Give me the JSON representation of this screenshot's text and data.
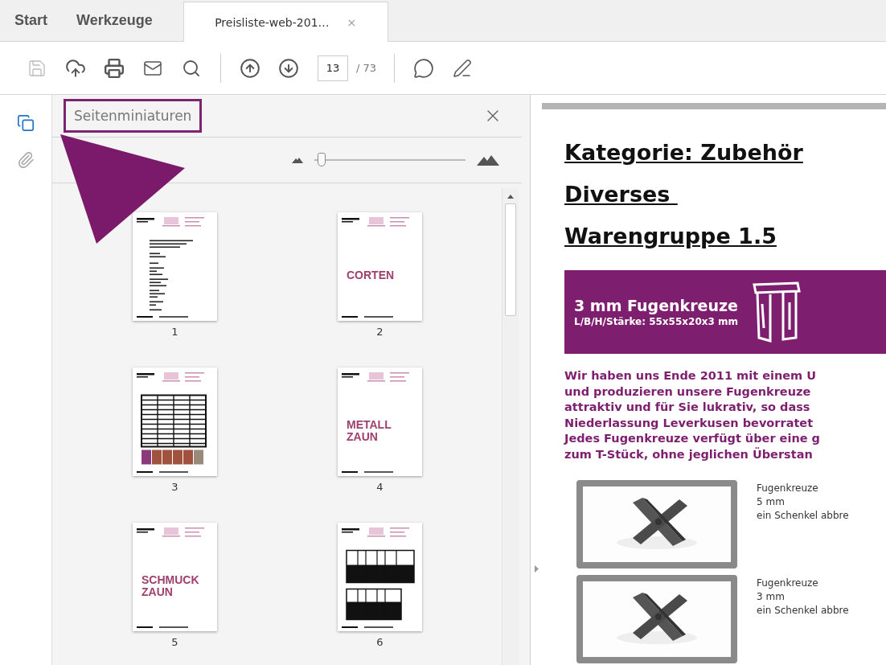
{
  "tabs": [
    {
      "label": "Start",
      "kind": "nav",
      "selected": false
    },
    {
      "label": "Werkzeuge",
      "kind": "nav",
      "selected": false
    },
    {
      "label": "Preisliste-web-201…",
      "kind": "document",
      "selected": true,
      "close_label": "×"
    }
  ],
  "toolbar": {
    "save_button": {
      "disabled": true
    },
    "page_field": {
      "value": "13"
    },
    "page_total": "/ 73"
  },
  "sidebar": {
    "tools": [
      {
        "kind": "pages",
        "selected": true
      },
      {
        "kind": "attachments",
        "selected": false
      }
    ]
  },
  "panel": {
    "title": "Seitenminiaturen",
    "title_highlighted": true,
    "size_slider": {
      "level": 0.05
    },
    "thumbnails": [
      {
        "page": "1",
        "kind": "text"
      },
      {
        "page": "2",
        "kind": "title",
        "title_lines": [
          "CORTEN"
        ]
      },
      {
        "page": "3",
        "kind": "table"
      },
      {
        "page": "4",
        "kind": "title",
        "title_lines": [
          "METALL",
          "ZAUN"
        ]
      },
      {
        "page": "5",
        "kind": "title",
        "title_lines": [
          "SCHMUCK",
          "ZAUN"
        ]
      },
      {
        "page": "6",
        "kind": "tables"
      }
    ]
  },
  "document": {
    "headings": [
      "Kategorie: Zubehör",
      "Diverses ",
      "Warengruppe 1.5"
    ],
    "banner": {
      "title": "3 mm Fugenkreuze",
      "subtitle": "L/B/H/Stärke: 55x55x20x3 mm"
    },
    "paragraph_lines": [
      "Wir haben uns Ende 2011 mit einem U",
      "und produzieren unsere Fugenkreuze",
      "attraktiv und für Sie lukrativ, so dass",
      "Niederlassung Leverkusen bevorratet",
      "Jedes Fugenkreuze verfügt über eine g",
      "zum T-Stück, ohne jeglichen Überstan"
    ],
    "products": [
      {
        "lines": [
          "Fugenkreuze",
          "5 mm",
          "ein Schenkel abbre"
        ]
      },
      {
        "lines": [
          "Fugenkreuze",
          "3 mm",
          "ein Schenkel abbre"
        ]
      }
    ]
  }
}
